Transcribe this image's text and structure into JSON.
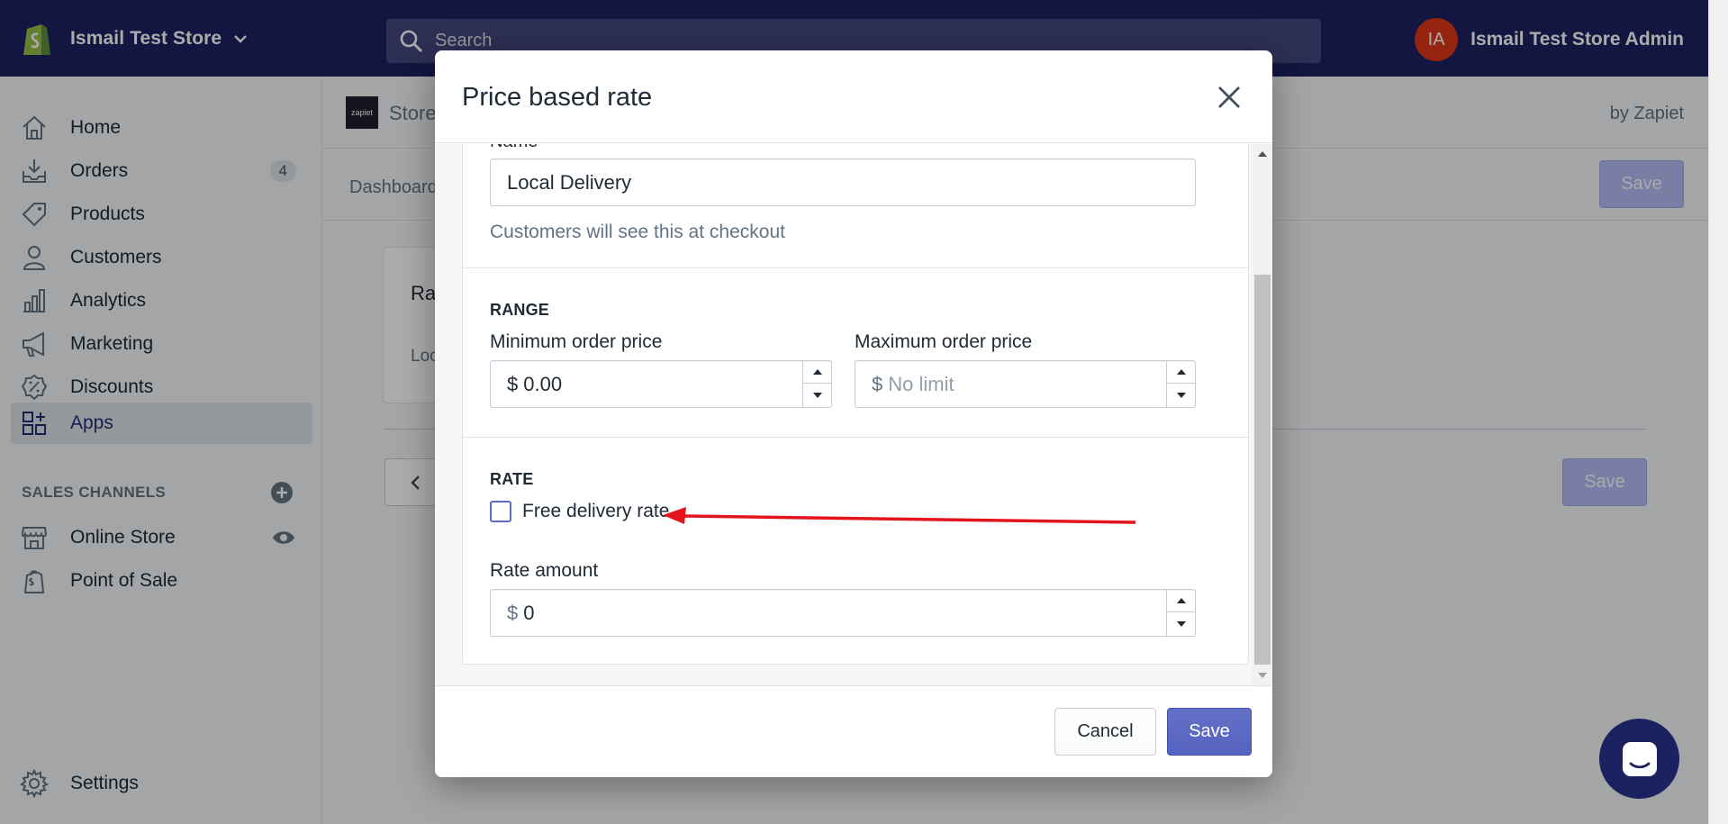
{
  "topbar": {
    "store_name": "Ismail Test Store",
    "search_placeholder": "Search",
    "avatar_initials": "IA",
    "account_name": "Ismail Test Store Admin"
  },
  "sidebar": {
    "items": [
      {
        "label": "Home",
        "icon": "home-icon"
      },
      {
        "label": "Orders",
        "icon": "orders-icon",
        "badge": "4"
      },
      {
        "label": "Products",
        "icon": "tag-icon"
      },
      {
        "label": "Customers",
        "icon": "person-icon"
      },
      {
        "label": "Analytics",
        "icon": "bar-chart-icon"
      },
      {
        "label": "Marketing",
        "icon": "megaphone-icon"
      },
      {
        "label": "Discounts",
        "icon": "discount-icon"
      },
      {
        "label": "Apps",
        "icon": "apps-icon",
        "active": true
      }
    ],
    "sales_channels_title": "SALES CHANNELS",
    "channels": [
      {
        "label": "Online Store",
        "icon": "store-icon"
      },
      {
        "label": "Point of Sale",
        "icon": "pos-bag-icon"
      }
    ],
    "settings_label": "Settings"
  },
  "app": {
    "logo_text": "zapiet",
    "name": "Store",
    "by": "by Zapiet",
    "subnav_first": "Dashboard",
    "save_label": "Save",
    "card_title": "Ra",
    "card_sub": "Loc"
  },
  "modal": {
    "title": "Price based rate",
    "name_label": "Name",
    "name_value": "Local Delivery",
    "name_help": "Customers will see this at checkout",
    "range_heading": "RANGE",
    "min_label": "Minimum order price",
    "min_prefix": "$",
    "min_value": "0.00",
    "max_label": "Maximum order price",
    "max_prefix": "$",
    "max_placeholder": "No limit",
    "rate_heading": "RATE",
    "free_label": "Free delivery rate",
    "free_checked": false,
    "rate_label": "Rate amount",
    "rate_prefix": "$",
    "rate_value": "0",
    "cancel_label": "Cancel",
    "save_label": "Save"
  },
  "colors": {
    "topbar": "#1c2260",
    "primary": "#5c6ac4",
    "annotation_arrow": "#e3141c"
  }
}
